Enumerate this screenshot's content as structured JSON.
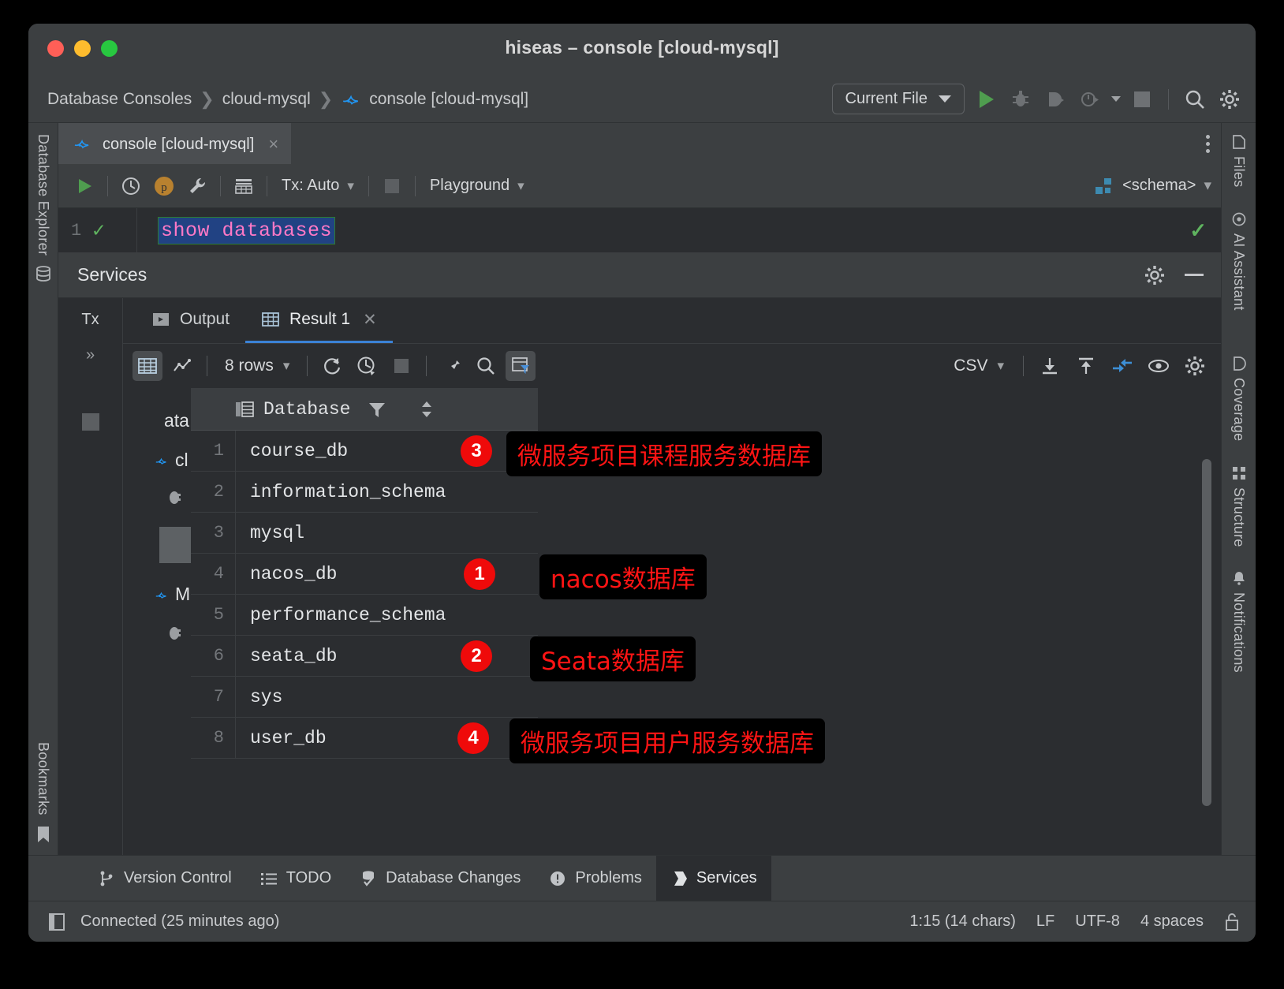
{
  "window": {
    "title": "hiseas – console [cloud-mysql]",
    "traffic": [
      "close",
      "minimize",
      "zoom"
    ]
  },
  "breadcrumb": {
    "items": [
      "Database Consoles",
      "cloud-mysql",
      "console [cloud-mysql]"
    ],
    "separator": "›"
  },
  "top_toolbar": {
    "run_config": "Current File",
    "icons": [
      "run-icon",
      "debug-icon",
      "run-with-coverage-icon",
      "profiler-icon",
      "stop-icon",
      "search-everywhere-icon",
      "settings-icon"
    ]
  },
  "editor_tab": {
    "label": "console [cloud-mysql]",
    "close": "×",
    "overflow": "more-options"
  },
  "console_toolbar": {
    "execute": "execute-icon",
    "history": "history-icon",
    "params": "p",
    "settings": "wrench-icon",
    "grid": "table-icon",
    "tx_mode": "Tx: Auto",
    "stop": "stop-icon",
    "schema_scope": "Playground",
    "session": "<schema>"
  },
  "sql": {
    "line_number": "1",
    "status": "✓",
    "text": "show databases",
    "right_status": "✓"
  },
  "services": {
    "title": "Services",
    "rail": {
      "tx": "Tx",
      "more": "»"
    },
    "tabs": [
      {
        "label": "Output",
        "icon": "output-icon",
        "active": false
      },
      {
        "label": "Result 1",
        "icon": "grid-icon",
        "active": true,
        "closable": true
      }
    ],
    "result_toolbar": {
      "view_grid": "grid-view-icon",
      "view_chart": "chart-view-icon",
      "rows": "8 rows",
      "reload": "reload-icon",
      "page_time": "query-time-icon",
      "stop": "stop-icon",
      "pin": "pin-icon",
      "search": "search-icon",
      "filter": "filter-icon",
      "format": "CSV",
      "download": "export-to-file-icon",
      "upload": "import-from-file-icon",
      "compare": "compare-icon",
      "preview": "eye-icon",
      "settings": "gear-icon"
    },
    "grid": {
      "column": "Database",
      "column_icon": "column-icon",
      "filter_icon": "filter-icon",
      "sort_icon": "sort-icon",
      "rows": [
        {
          "index": "1",
          "value": "course_db"
        },
        {
          "index": "2",
          "value": "information_schema"
        },
        {
          "index": "3",
          "value": "mysql"
        },
        {
          "index": "4",
          "value": "nacos_db"
        },
        {
          "index": "5",
          "value": "performance_schema"
        },
        {
          "index": "6",
          "value": "seata_db"
        },
        {
          "index": "7",
          "value": "sys"
        },
        {
          "index": "8",
          "value": "user_db"
        }
      ]
    }
  },
  "annotations": [
    {
      "badge": "3",
      "text": "微服务项目课程服务数据库",
      "row": 1
    },
    {
      "badge": "1",
      "text": "nacos数据库",
      "row": 4
    },
    {
      "badge": "2",
      "text": "Seata数据库",
      "row": 6
    },
    {
      "badge": "4",
      "text": "微服务项目用户服务数据库",
      "row": 8
    }
  ],
  "left_rail": {
    "top": "Database Explorer",
    "bottom": "Bookmarks"
  },
  "right_rail": [
    {
      "label": "Files",
      "icon": "files-icon"
    },
    {
      "label": "AI Assistant",
      "icon": "ai-icon"
    },
    {
      "label": "Coverage",
      "icon": "coverage-icon"
    },
    {
      "label": "Structure",
      "icon": "structure-icon"
    },
    {
      "label": "Notifications",
      "icon": "bell-icon"
    }
  ],
  "bottom_bar": [
    {
      "label": "Version Control",
      "icon": "branch-icon",
      "active": false
    },
    {
      "label": "TODO",
      "icon": "list-icon",
      "active": false
    },
    {
      "label": "Database Changes",
      "icon": "db-changes-icon",
      "active": false
    },
    {
      "label": "Problems",
      "icon": "warning-icon",
      "active": false
    },
    {
      "label": "Services",
      "icon": "services-icon",
      "active": true
    }
  ],
  "status_bar": {
    "connection": "Connected (25 minutes ago)",
    "caret": "1:15 (14 chars)",
    "line_sep": "LF",
    "encoding": "UTF-8",
    "indent": "4 spaces",
    "lock": "lock-icon"
  },
  "colors": {
    "accent_blue": "#3b82d6",
    "annotation_red": "#ff1414",
    "badge_red": "#ef0a0a",
    "run_green": "#4f9d4f",
    "sql_keyword": "#ff79c6",
    "selection_blue": "#214283"
  }
}
